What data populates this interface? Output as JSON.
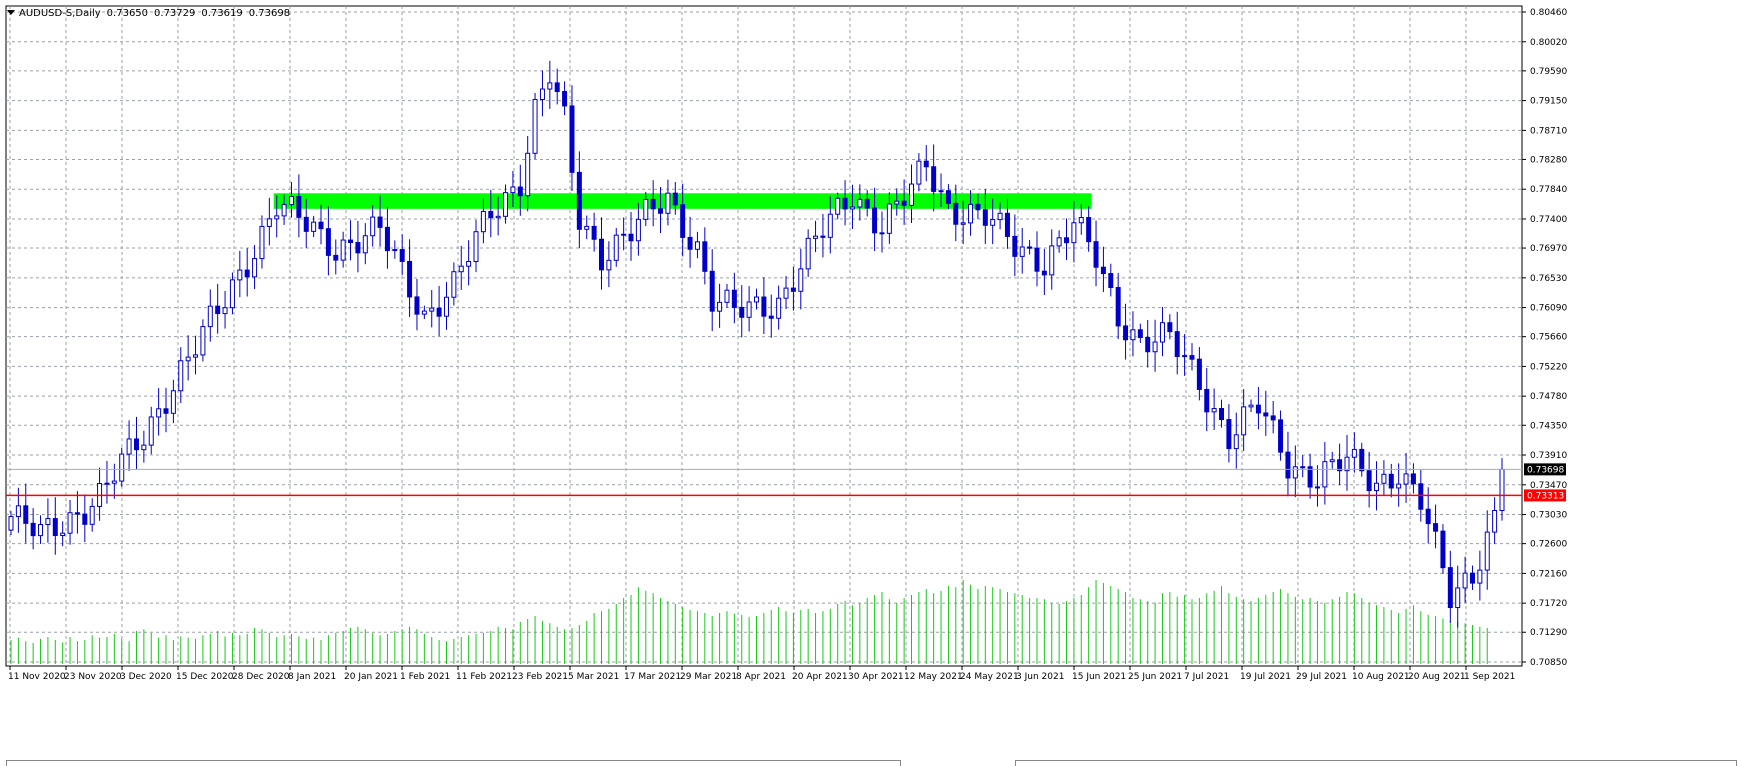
{
  "window": {
    "symbol": "AUDUSD-S,Daily",
    "ohlc": [
      "0.73650",
      "0.73729",
      "0.73619",
      "0.73698"
    ]
  },
  "colors": {
    "background": "#ffffff",
    "grid": "#9aa0a6",
    "candle": "#0000c8",
    "volume": "#19c819",
    "zone": "#00ff00",
    "support_line": "#ff0000",
    "price_line": "#a0aec0",
    "label_bid_bg": "#000000",
    "label_support_bg": "#ff0000"
  },
  "chart_data": {
    "type": "candlestick",
    "symbol": "AUDUSD-S",
    "timeframe": "Daily",
    "last_price": "0.73698",
    "ylim": [
      0.7085,
      0.8046
    ],
    "y_ticks": [
      "0.80460",
      "0.80020",
      "0.79590",
      "0.79150",
      "0.78710",
      "0.78280",
      "0.77840",
      "0.77400",
      "0.76970",
      "0.76530",
      "0.76090",
      "0.75660",
      "0.75220",
      "0.74780",
      "0.74350",
      "0.73910",
      "0.73470",
      "0.73030",
      "0.72600",
      "0.72160",
      "0.71720",
      "0.71290",
      "0.70850"
    ],
    "x_ticks": [
      "11 Nov 2020",
      "23 Nov 2020",
      "3 Dec 2020",
      "15 Dec 2020",
      "28 Dec 2020",
      "8 Jan 2021",
      "20 Jan 2021",
      "1 Feb 2021",
      "11 Feb 2021",
      "23 Feb 2021",
      "5 Mar 2021",
      "17 Mar 2021",
      "29 Mar 2021",
      "8 Apr 2021",
      "20 Apr 2021",
      "30 Apr 2021",
      "12 May 2021",
      "24 May 2021",
      "3 Jun 2021",
      "15 Jun 2021",
      "25 Jun 2021",
      "7 Jul 2021",
      "19 Jul 2021",
      "29 Jul 2021",
      "10 Aug 2021",
      "20 Aug 2021",
      "1 Sep 2021"
    ],
    "grid": true,
    "resistance_zone": {
      "low": 0.7755,
      "high": 0.7778,
      "from_index": 36,
      "to_index": 146
    },
    "support_line": {
      "value": 0.73313,
      "label": "0.73313"
    },
    "bid_line": {
      "value": 0.73698,
      "label": "0.73698"
    },
    "anchors": [
      [
        0,
        0.73
      ],
      [
        4,
        0.727
      ],
      [
        8,
        0.73
      ],
      [
        12,
        0.733
      ],
      [
        18,
        0.742
      ],
      [
        22,
        0.75
      ],
      [
        28,
        0.76
      ],
      [
        32,
        0.768
      ],
      [
        36,
        0.776
      ],
      [
        44,
        0.77
      ],
      [
        50,
        0.772
      ],
      [
        56,
        0.76
      ],
      [
        60,
        0.764
      ],
      [
        65,
        0.775
      ],
      [
        69,
        0.78
      ],
      [
        71,
        0.79
      ],
      [
        73,
        0.795
      ],
      [
        75,
        0.788
      ],
      [
        77,
        0.774
      ],
      [
        80,
        0.769
      ],
      [
        84,
        0.772
      ],
      [
        89,
        0.777
      ],
      [
        93,
        0.77
      ],
      [
        95,
        0.762
      ],
      [
        98,
        0.76
      ],
      [
        104,
        0.762
      ],
      [
        110,
        0.772
      ],
      [
        114,
        0.778
      ],
      [
        118,
        0.773
      ],
      [
        122,
        0.778
      ],
      [
        124,
        0.782
      ],
      [
        127,
        0.776
      ],
      [
        132,
        0.774
      ],
      [
        136,
        0.77
      ],
      [
        140,
        0.768
      ],
      [
        144,
        0.773
      ],
      [
        147,
        0.768
      ],
      [
        150,
        0.76
      ],
      [
        153,
        0.756
      ],
      [
        157,
        0.756
      ],
      [
        161,
        0.75
      ],
      [
        165,
        0.742
      ],
      [
        169,
        0.746
      ],
      [
        173,
        0.738
      ],
      [
        177,
        0.736
      ],
      [
        181,
        0.738
      ],
      [
        185,
        0.735
      ],
      [
        188,
        0.737
      ],
      [
        191,
        0.732
      ],
      [
        195,
        0.718
      ],
      [
        198,
        0.722
      ],
      [
        201,
        0.73
      ],
      [
        202,
        0.7365
      ]
    ],
    "volumes": [
      40,
      44,
      38,
      35,
      42,
      45,
      40,
      36,
      45,
      38,
      40,
      48,
      44,
      45,
      50,
      42,
      38,
      55,
      58,
      52,
      44,
      48,
      40,
      46,
      44,
      42,
      48,
      50,
      55,
      46,
      52,
      48,
      50,
      60,
      58,
      52,
      45,
      48,
      50,
      46,
      42,
      44,
      40,
      48,
      52,
      55,
      60,
      62,
      58,
      52,
      48,
      50,
      55,
      58,
      62,
      58,
      50,
      45,
      40,
      38,
      42,
      45,
      48,
      50,
      52,
      55,
      62,
      60,
      58,
      70,
      75,
      80,
      72,
      68,
      62,
      58,
      60,
      65,
      72,
      85,
      88,
      92,
      100,
      110,
      115,
      128,
      122,
      118,
      110,
      105,
      100,
      95,
      90,
      88,
      85,
      80,
      85,
      88,
      84,
      82,
      78,
      80,
      85,
      90,
      95,
      88,
      85,
      90,
      92,
      85,
      88,
      92,
      100,
      105,
      98,
      102,
      110,
      115,
      120,
      108,
      102,
      110,
      115,
      120,
      125,
      118,
      122,
      130,
      128,
      140,
      132,
      125,
      130,
      128,
      125,
      120,
      118,
      115,
      110,
      110,
      108,
      102,
      100,
      105,
      110,
      115,
      128,
      140,
      135,
      130,
      125,
      120,
      110,
      108,
      105,
      102,
      118,
      120,
      112,
      115,
      108,
      110,
      118,
      122,
      130,
      118,
      112,
      108,
      105,
      110,
      115,
      120,
      125,
      118,
      112,
      108,
      110,
      105,
      102,
      108,
      112,
      120,
      118,
      110,
      102,
      98,
      95,
      90,
      85,
      92,
      98,
      88,
      82,
      80,
      76,
      72,
      70,
      68,
      65,
      62,
      60
    ]
  }
}
